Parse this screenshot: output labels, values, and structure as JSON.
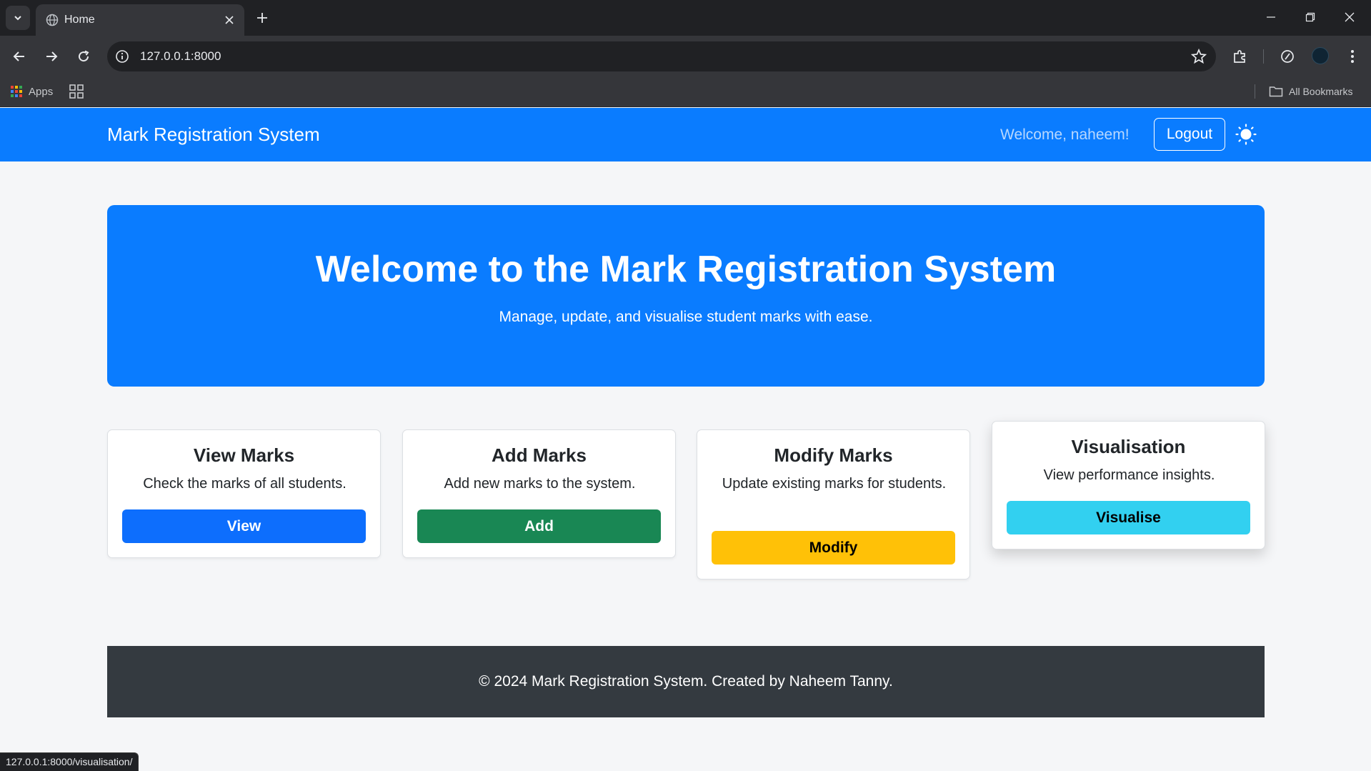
{
  "browser": {
    "tab_title": "Home",
    "url": "127.0.0.1:8000",
    "bookmarks": {
      "apps_label": "Apps",
      "all_bookmarks_label": "All Bookmarks"
    },
    "status_url": "127.0.0.1:8000/visualisation/"
  },
  "navbar": {
    "brand": "Mark Registration System",
    "welcome": "Welcome, naheem!",
    "logout_label": "Logout"
  },
  "hero": {
    "title": "Welcome to the Mark Registration System",
    "subtitle": "Manage, update, and visualise student marks with ease."
  },
  "cards": [
    {
      "title": "View Marks",
      "text": "Check the marks of all students.",
      "button": "View",
      "button_color": "#0d6efd",
      "button_text_color": "#ffffff"
    },
    {
      "title": "Add Marks",
      "text": "Add new marks to the system.",
      "button": "Add",
      "button_color": "#198754",
      "button_text_color": "#ffffff"
    },
    {
      "title": "Modify Marks",
      "text": "Update existing marks for students.",
      "button": "Modify",
      "button_color": "#ffc107",
      "button_text_color": "#000000"
    },
    {
      "title": "Visualisation",
      "text": "View performance insights.",
      "button": "Visualise",
      "button_color": "#32d0f0",
      "button_text_color": "#000000"
    }
  ],
  "footer": {
    "text": "© 2024 Mark Registration System. Created by Naheem Tanny."
  },
  "colors": {
    "primary": "#0a7cff",
    "footer_bg": "#343a40",
    "page_bg": "#f5f6f8"
  }
}
